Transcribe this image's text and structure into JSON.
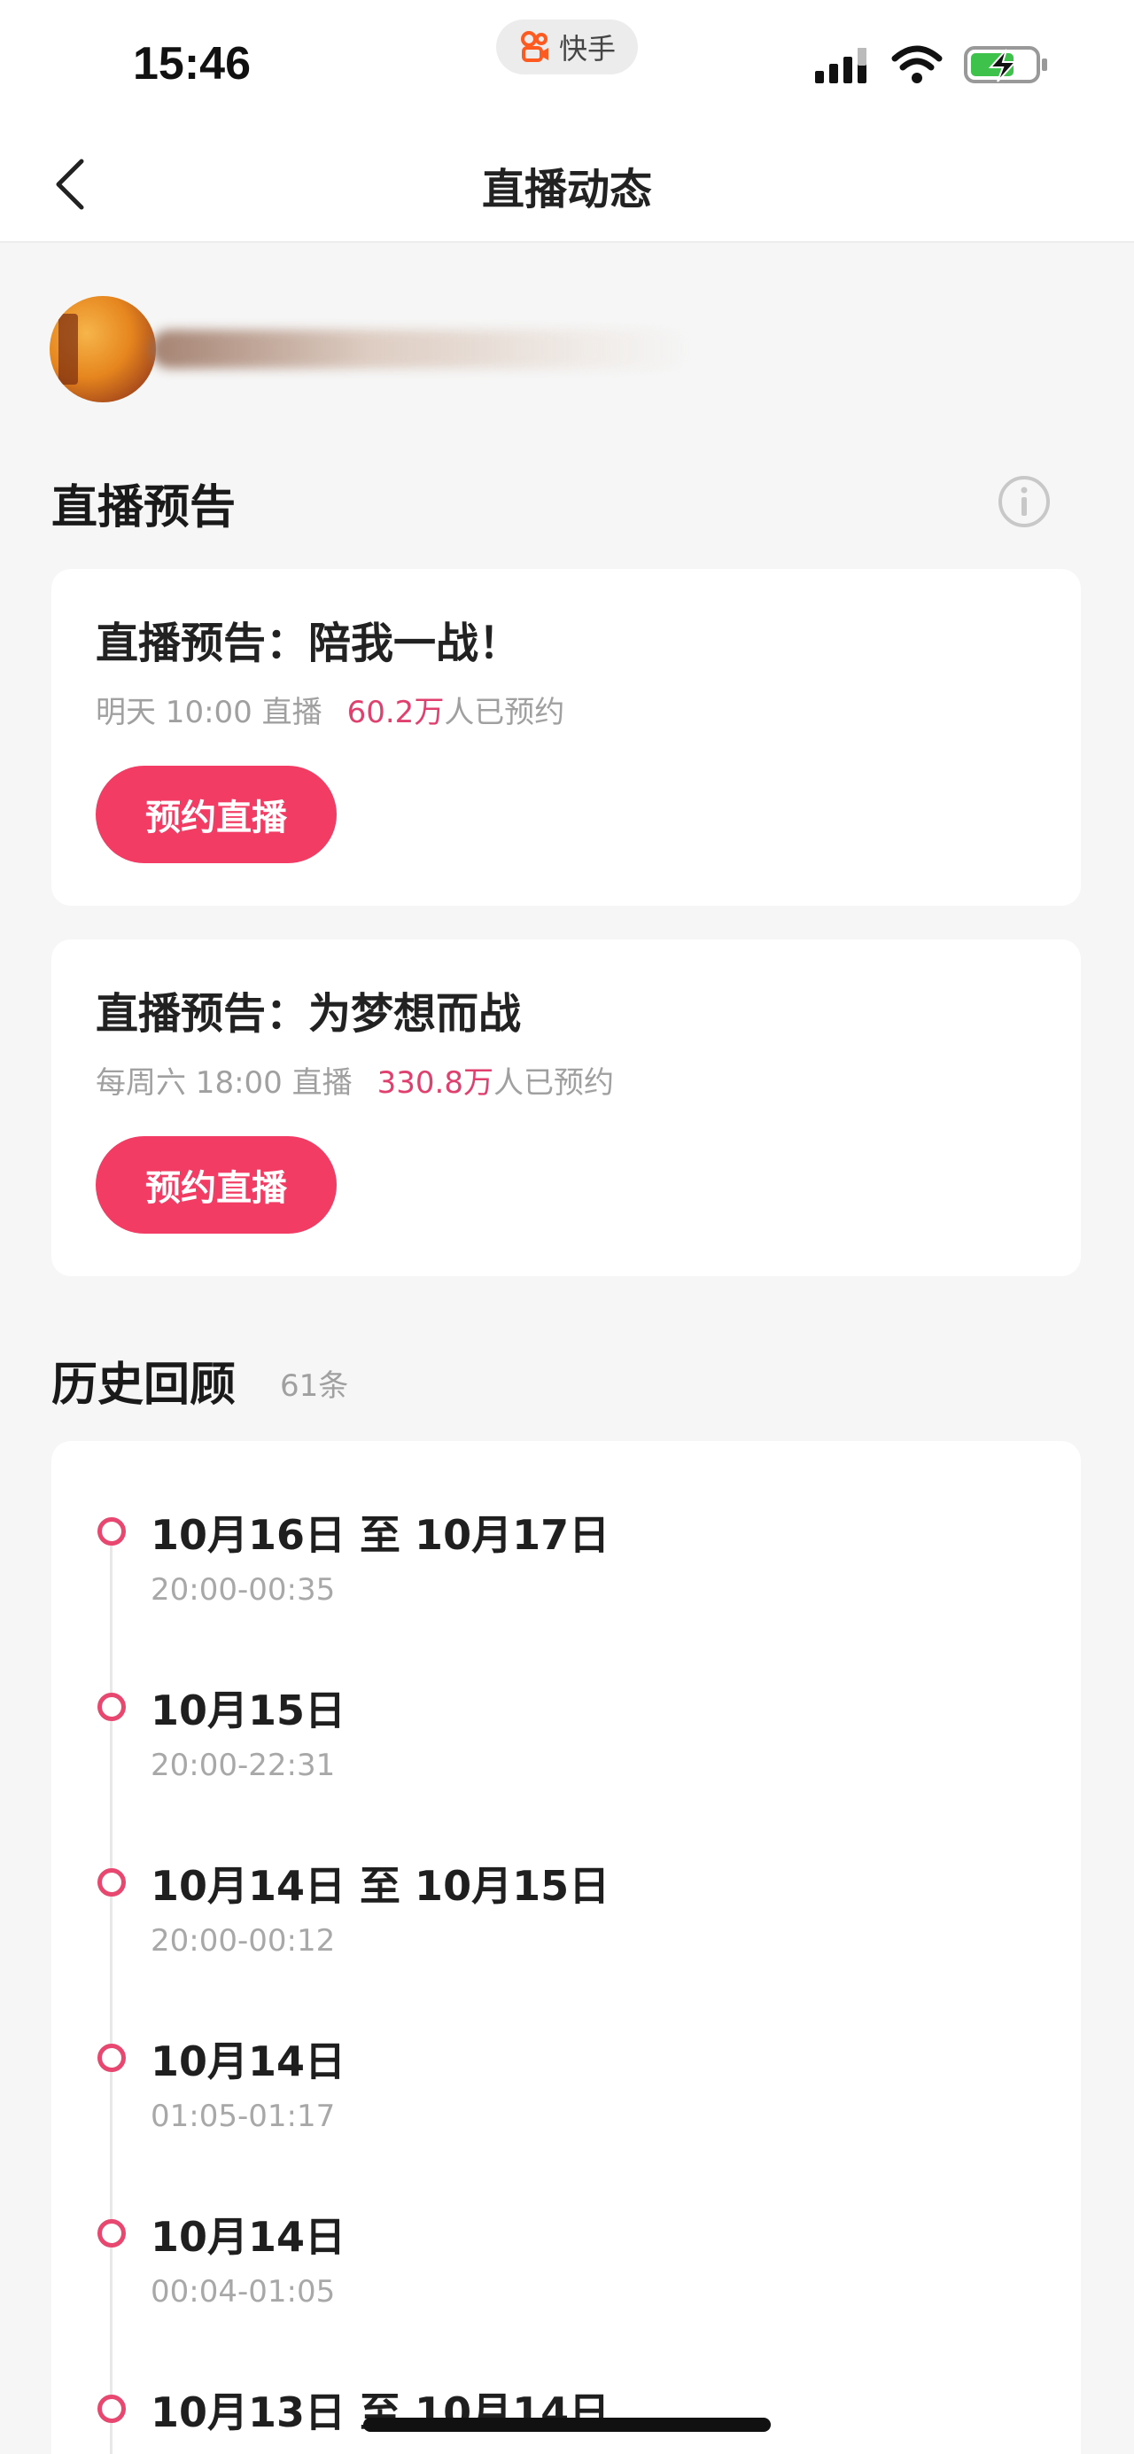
{
  "status_bar": {
    "time": "15:46",
    "app_pill": "快手"
  },
  "nav": {
    "title": "直播动态"
  },
  "preview_section": {
    "title": "直播预告",
    "cards": [
      {
        "title": "直播预告：陪我一战！",
        "schedule": "明天 10:00 直播",
        "count": "60.2万",
        "count_suffix": "人已预约",
        "button": "预约直播"
      },
      {
        "title": "直播预告：为梦想而战",
        "schedule": "每周六 18:00 直播",
        "count": "330.8万",
        "count_suffix": "人已预约",
        "button": "预约直播"
      }
    ]
  },
  "history_section": {
    "title": "历史回顾",
    "count": "61条",
    "items": [
      {
        "date": "10月16日 至 10月17日",
        "time": "20:00-00:35"
      },
      {
        "date": "10月15日",
        "time": "20:00-22:31"
      },
      {
        "date": "10月14日 至 10月15日",
        "time": "20:00-00:12"
      },
      {
        "date": "10月14日",
        "time": "01:05-01:17"
      },
      {
        "date": "10月14日",
        "time": "00:04-01:05"
      },
      {
        "date": "10月13日 至 10月14日",
        "time": ""
      }
    ]
  },
  "colors": {
    "accent": "#f23c64",
    "count_text": "#e0406e",
    "timeline_dot": "#e8476f",
    "background": "#f6f6f6"
  },
  "icons": [
    "signal-icon",
    "wifi-icon",
    "battery-charging-icon",
    "back-chevron-icon",
    "info-icon",
    "kuaishou-logo-icon"
  ]
}
